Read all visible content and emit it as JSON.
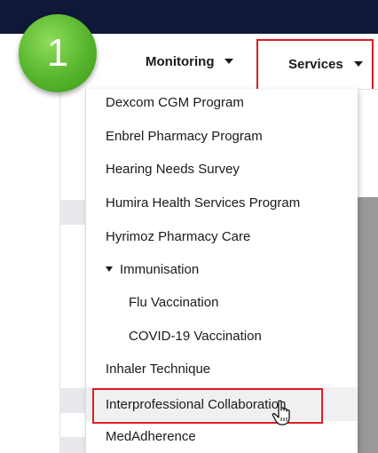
{
  "step_badge": {
    "number": "1",
    "color": "#56b52c"
  },
  "nav": {
    "monitoring_label": "Monitoring",
    "services_label": "Services"
  },
  "dropdown": {
    "items": [
      {
        "label": "Dexcom CGM Program"
      },
      {
        "label": "Enbrel Pharmacy Program"
      },
      {
        "label": "Hearing Needs Survey"
      },
      {
        "label": "Humira Health Services Program"
      },
      {
        "label": "Hyrimoz Pharmacy Care"
      },
      {
        "label": "Immunisation"
      },
      {
        "label": "Flu Vaccination"
      },
      {
        "label": "COVID-19 Vaccination"
      },
      {
        "label": "Inhaler Technique"
      },
      {
        "label": "Interprofessional Collaboration"
      },
      {
        "label": "MedAdherence"
      }
    ]
  },
  "colors": {
    "highlight": "#e01b22",
    "topbar": "#101838",
    "hover": "#f0f0f2"
  },
  "icons": {
    "caret": "caret-down-icon",
    "cursor": "hand-pointer-cursor-icon"
  }
}
